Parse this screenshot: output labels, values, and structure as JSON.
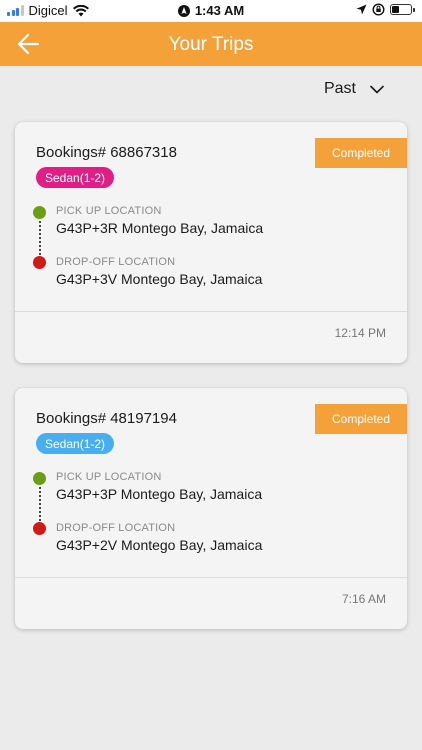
{
  "status_bar": {
    "carrier": "Digicel",
    "time": "1:43 AM"
  },
  "header": {
    "title": "Your Trips"
  },
  "filter": {
    "selected": "Past"
  },
  "labels": {
    "pickup": "PICK UP LOCATION",
    "dropoff": "DROP-OFF LOCATION"
  },
  "trips": [
    {
      "booking": "Bookings# 68867318",
      "status": "Completed",
      "vehicle": "Sedan(1-2)",
      "pickup": "G43P+3R Montego Bay,  Jamaica",
      "dropoff": "G43P+3V Montego Bay,  Jamaica",
      "time": "12:14 PM"
    },
    {
      "booking": "Bookings# 48197194",
      "status": "Completed",
      "vehicle": "Sedan(1-2)",
      "pickup": "G43P+3P Montego Bay,  Jamaica",
      "dropoff": "G43P+2V Montego Bay, Jamaica",
      "time": "7:16 AM"
    }
  ],
  "colors": {
    "accent": "#f5a13a",
    "tag_pink": "#e01f86",
    "tag_blue": "#47aef0",
    "pickup_dot": "#6a9e14",
    "dropoff_dot": "#d11a16"
  },
  "icons": {
    "back": "arrow-left-icon",
    "filter": "chevron-down-icon"
  }
}
